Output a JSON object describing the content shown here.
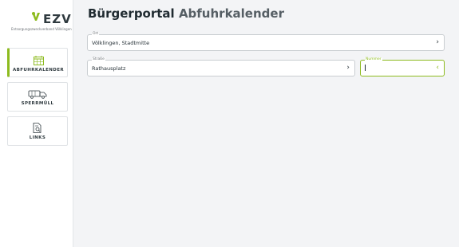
{
  "brand": {
    "logo_text": "EZV",
    "subtitle": "Entsorgungszweckverband Völklingen",
    "accent_color": "#8dbb1f"
  },
  "header": {
    "title_main": "Bürgerportal",
    "title_accent": "Abfuhrkalender"
  },
  "sidebar": {
    "items": [
      {
        "label": "ABFUHRKALENDER",
        "icon": "calendar-icon",
        "active": true
      },
      {
        "label": "SPERRMÜLL",
        "icon": "truck-icon",
        "active": false
      },
      {
        "label": "LINKS",
        "icon": "document-search-icon",
        "active": false
      }
    ]
  },
  "form": {
    "ort": {
      "label": "Ort",
      "value": "Völklingen, Stadtmitte",
      "chevron": "›"
    },
    "strasse": {
      "label": "Straße",
      "value": "Rathausplatz",
      "chevron": "›"
    },
    "nummer": {
      "label": "Nummer",
      "value": "",
      "chevron": "‹"
    }
  }
}
